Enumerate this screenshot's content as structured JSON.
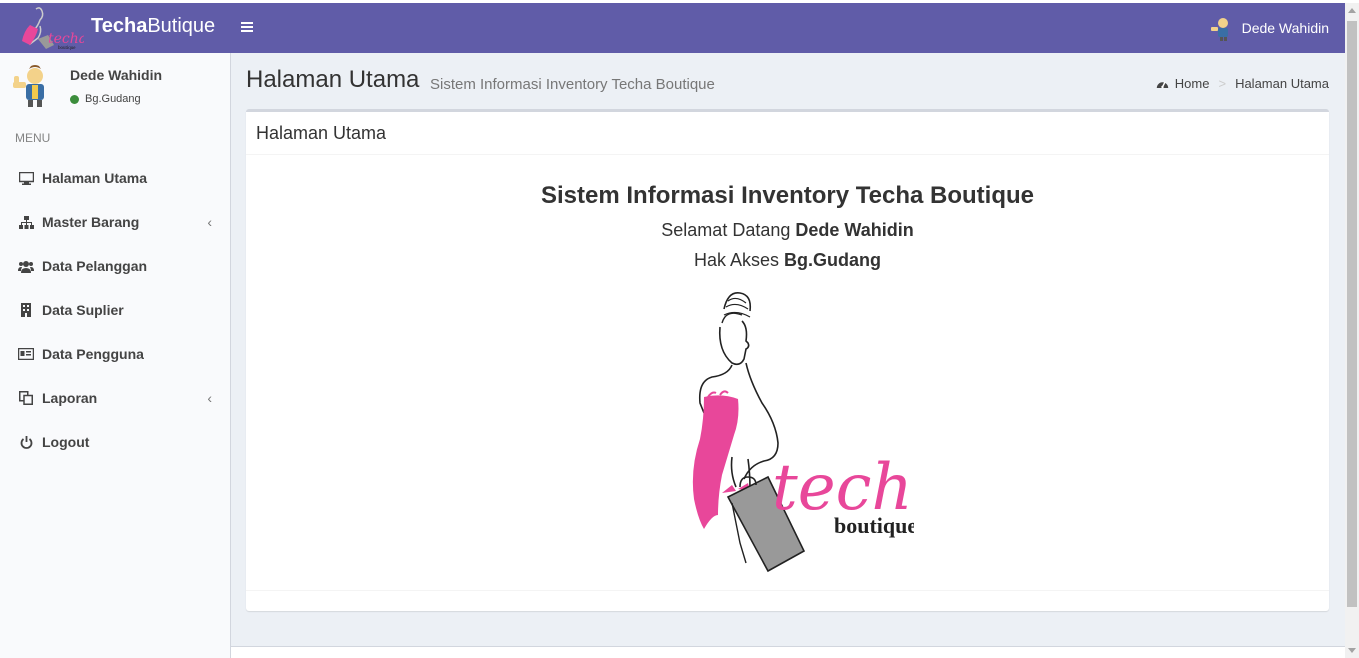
{
  "header": {
    "brand_bold": "Techa",
    "brand_rest": "Butique",
    "user_name": "Dede Wahidin",
    "toggle_icon": "hamburger-icon"
  },
  "sidebar": {
    "user_name": "Dede Wahidin",
    "user_status": "Bg.Gudang",
    "menu_header": "MENU",
    "items": [
      {
        "label": "Halaman Utama",
        "icon": "monitor-icon"
      },
      {
        "label": "Master Barang",
        "icon": "sitemap-icon",
        "submenu": true
      },
      {
        "label": "Data Pelanggan",
        "icon": "users-icon"
      },
      {
        "label": "Data Suplier",
        "icon": "building-icon"
      },
      {
        "label": "Data Pengguna",
        "icon": "id-card-icon"
      },
      {
        "label": "Laporan",
        "icon": "copy-icon",
        "submenu": true
      },
      {
        "label": "Logout",
        "icon": "power-icon"
      }
    ]
  },
  "content": {
    "title": "Halaman Utama",
    "subtitle": "Sistem Informasi Inventory Techa Boutique",
    "breadcrumb": [
      "Home",
      "Halaman Utama"
    ]
  },
  "box": {
    "header": "Halaman Utama",
    "title": "Sistem Informasi Inventory Techa Boutique",
    "welcome_prefix": "Selamat Datang ",
    "welcome_name": "Dede Wahidin",
    "access_prefix": "Hak Akses ",
    "access_role": "Bg.Gudang",
    "logo_word1": "techa",
    "logo_word2": "boutique"
  },
  "colors": {
    "header_bg": "#605ca8",
    "accent_pink": "#e8479a",
    "status_online": "#3c8d3c"
  }
}
